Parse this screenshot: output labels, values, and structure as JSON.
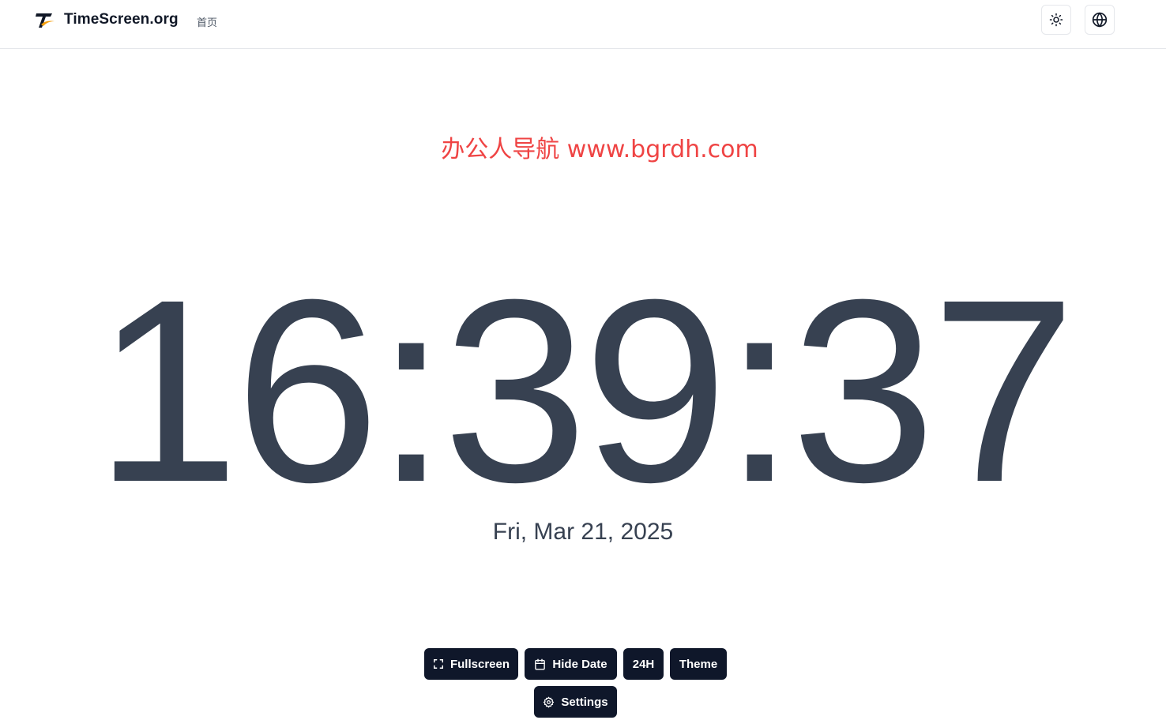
{
  "header": {
    "site_title": "TimeScreen.org",
    "nav_home": "首页",
    "logo_icon": "timescreen-logo-icon",
    "theme_toggle_icon": "sun-icon",
    "language_icon": "globe-icon"
  },
  "watermark": "办公人导航 www.bgrdh.com",
  "clock": {
    "time": "16:39:37",
    "date": "Fri, Mar 21, 2025"
  },
  "controls": {
    "fullscreen_label": "Fullscreen",
    "fullscreen_icon": "expand-icon",
    "hide_date_label": "Hide Date",
    "hide_date_icon": "calendar-icon",
    "format_label": "24H",
    "theme_label": "Theme",
    "settings_label": "Settings",
    "settings_icon": "gear-icon"
  },
  "colors": {
    "clock_text": "#374151",
    "button_bg": "#0f172a",
    "watermark": "#ef4444"
  }
}
